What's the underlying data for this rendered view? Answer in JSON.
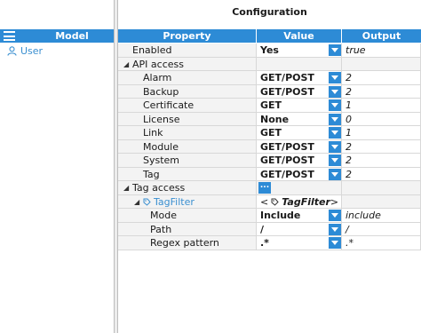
{
  "model_panel": {
    "header": "Model",
    "items": [
      {
        "label": "User",
        "icon": "user-icon"
      }
    ]
  },
  "config_panel": {
    "title": "Configuration",
    "columns": {
      "property": "Property",
      "value": "Value",
      "output": "Output"
    },
    "rows": [
      {
        "label": "Enabled",
        "value": "Yes",
        "output": "true",
        "dropdown": true
      },
      {
        "label": "API access",
        "group": true
      },
      {
        "label": "Alarm",
        "value": "GET/POST",
        "output": "2",
        "dropdown": true
      },
      {
        "label": "Backup",
        "value": "GET/POST",
        "output": "2",
        "dropdown": true
      },
      {
        "label": "Certificate",
        "value": "GET",
        "output": "1",
        "dropdown": true
      },
      {
        "label": "License",
        "value": "None",
        "output": "0",
        "dropdown": true
      },
      {
        "label": "Link",
        "value": "GET",
        "output": "1",
        "dropdown": true
      },
      {
        "label": "Module",
        "value": "GET/POST",
        "output": "2",
        "dropdown": true
      },
      {
        "label": "System",
        "value": "GET/POST",
        "output": "2",
        "dropdown": true
      },
      {
        "label": "Tag",
        "value": "GET/POST",
        "output": "2",
        "dropdown": true
      },
      {
        "label": "Tag access",
        "group": true,
        "more_button": "..."
      },
      {
        "label": "TagFilter",
        "subgroup": true,
        "value_prefix": "<",
        "value_name": "TagFilter",
        "value_suffix": ">"
      },
      {
        "label": "Mode",
        "value": "Include",
        "output": "include",
        "dropdown": true
      },
      {
        "label": "Path",
        "value": "/",
        "output": "/",
        "dropdown": true
      },
      {
        "label": "Regex pattern",
        "value": ".*",
        "output": ".*",
        "dropdown": true
      }
    ]
  },
  "colors": {
    "accent": "#2d8bd6",
    "link": "#3a8fd0"
  }
}
